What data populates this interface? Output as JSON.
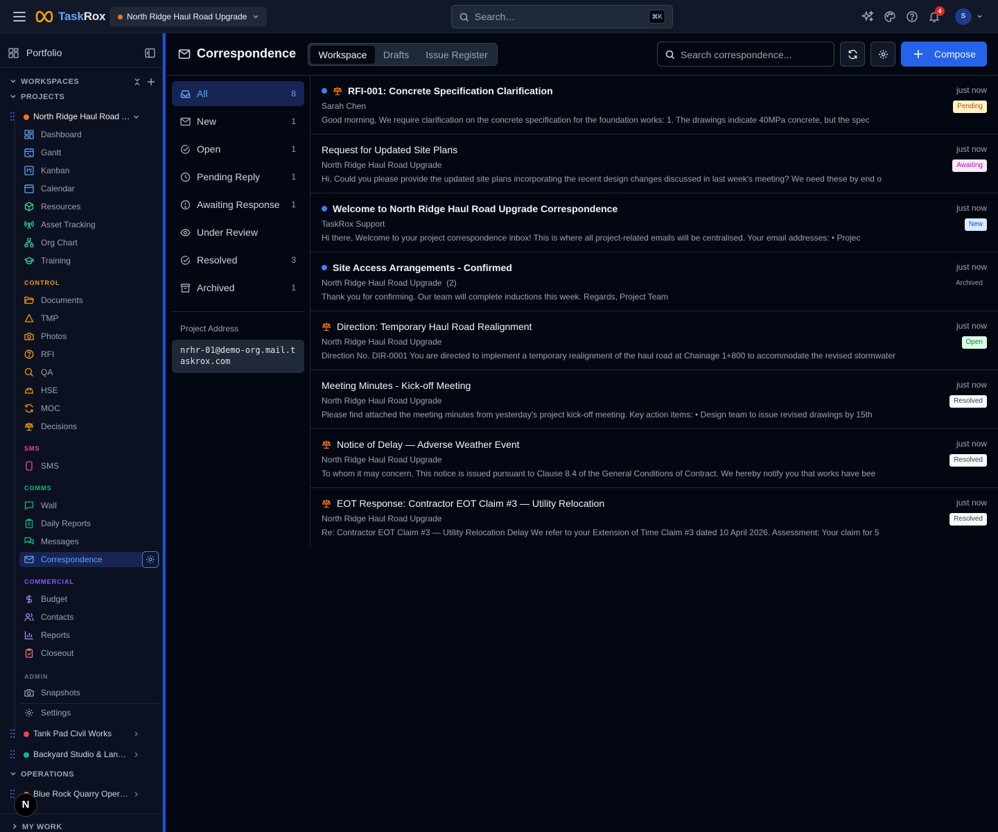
{
  "topbar": {
    "brand_a": "Task",
    "brand_b": "Rox",
    "project": "North Ridge Haul Road Upgrade",
    "search_placeholder": "Search…",
    "search_kbd": "⌘K",
    "notifications": "4",
    "avatar": "S"
  },
  "sidebar": {
    "portfolio": "Portfolio",
    "workspaces": "WORKSPACES",
    "projects": "PROJECTS",
    "active_project": "North Ridge Haul Road Upgrade",
    "nav": {
      "dashboard": "Dashboard",
      "gantt": "Gantt",
      "kanban": "Kanban",
      "calendar": "Calendar",
      "resources": "Resources",
      "asset_tracking": "Asset Tracking",
      "org_chart": "Org Chart",
      "training": "Training",
      "documents": "Documents",
      "tmp": "TMP",
      "photos": "Photos",
      "rfi": "RFI",
      "qa": "QA",
      "hse": "HSE",
      "moc": "MOC",
      "decisions": "Decisions",
      "sms": "SMS",
      "wall": "Wall",
      "daily_reports": "Daily Reports",
      "messages": "Messages",
      "correspondence": "Correspondence",
      "budget": "Budget",
      "contacts": "Contacts",
      "reports": "Reports",
      "closeout": "Closeout",
      "snapshots": "Snapshots",
      "settings": "Settings"
    },
    "groups": {
      "control": "CONTROL",
      "sms": "SMS",
      "comms": "COMMS",
      "commercial": "COMMERCIAL",
      "admin": "ADMIN"
    },
    "other_projects": [
      {
        "name": "Tank Pad Civil Works",
        "color": "#ef4444"
      },
      {
        "name": "Backyard Studio & Landscaping",
        "color": "#10b981"
      }
    ],
    "operations": "OPERATIONS",
    "operations_project": {
      "name": "Blue Rock Quarry Operations",
      "color": "#f97316"
    },
    "my_work": "MY WORK",
    "fab": "N"
  },
  "header": {
    "title": "Correspondence",
    "tabs": [
      "Workspace",
      "Drafts",
      "Issue Register"
    ],
    "search_placeholder": "Search correspondence...",
    "compose": "Compose"
  },
  "filters": {
    "items": [
      {
        "label": "All",
        "count": "8"
      },
      {
        "label": "New",
        "count": "1"
      },
      {
        "label": "Open",
        "count": "1"
      },
      {
        "label": "Pending Reply",
        "count": "1"
      },
      {
        "label": "Awaiting Response",
        "count": "1"
      },
      {
        "label": "Under Review",
        "count": ""
      },
      {
        "label": "Resolved",
        "count": "3"
      },
      {
        "label": "Archived",
        "count": "1"
      }
    ],
    "address_label": "Project Address",
    "address": "nrhr-01@demo-org.mail.taskrox.com"
  },
  "messages": [
    {
      "subject": "RFI-001: Concrete Specification Clarification",
      "from": "Sarah Chen",
      "preview": "Good morning, We require clarification on the concrete specification for the foundation works: 1. The drawings indicate 40MPa concrete, but the spec",
      "time": "just now",
      "status": "Pending"
    },
    {
      "subject": "Request for Updated Site Plans",
      "from": "North Ridge Haul Road Upgrade",
      "preview": "Hi, Could you please provide the updated site plans incorporating the recent design changes discussed in last week's meeting? We need these by end o",
      "time": "just now",
      "status": "Awaiting"
    },
    {
      "subject": "Welcome to North Ridge Haul Road Upgrade Correspondence",
      "from": "TaskRox Support",
      "preview": "Hi there, Welcome to your project correspondence inbox! This is where all project-related emails will be centralised. Your email addresses: • Projec",
      "time": "just now",
      "status": "New"
    },
    {
      "subject": "Site Access Arrangements - Confirmed",
      "from": "North Ridge Haul Road Upgrade",
      "count": "(2)",
      "preview": "Thank you for confirming. Our team will complete inductions this week. Regards, Project Team",
      "time": "just now",
      "status": "Archived"
    },
    {
      "subject": "Direction: Temporary Haul Road Realignment",
      "from": "North Ridge Haul Road Upgrade",
      "preview": "Direction No. DIR-0001 You are directed to implement a temporary realignment of the haul road at Chainage 1+800 to accommodate the revised stormwater",
      "time": "just now",
      "status": "Open"
    },
    {
      "subject": "Meeting Minutes - Kick-off Meeting",
      "from": "North Ridge Haul Road Upgrade",
      "preview": "Please find attached the meeting minutes from yesterday's project kick-off meeting. Key action items: • Design team to issue revised drawings by 15th",
      "time": "just now",
      "status": "Resolved"
    },
    {
      "subject": "Notice of Delay — Adverse Weather Event",
      "from": "North Ridge Haul Road Upgrade",
      "preview": "To whom it may concern, This notice is issued pursuant to Clause 8.4 of the General Conditions of Contract. We hereby notify you that works have bee",
      "time": "just now",
      "status": "Resolved"
    },
    {
      "subject": "EOT Response: Contractor EOT Claim #3 — Utility Relocation",
      "from": "North Ridge Haul Road Upgrade",
      "preview": "Re: Contractor EOT Claim #3 — Utility Relocation Delay We refer to your Extension of Time Claim #3 dated 10 April 2026. Assessment: Your claim for 5",
      "time": "just now",
      "status": "Resolved"
    }
  ],
  "colors": {
    "accent": "#2563eb",
    "active_bg": "#172554",
    "control_group": "#f59e0b",
    "sms_group": "#ec4899",
    "comms_group": "#10b981",
    "commercial_group": "#8b5cf6",
    "admin_group": "#6b7280"
  }
}
